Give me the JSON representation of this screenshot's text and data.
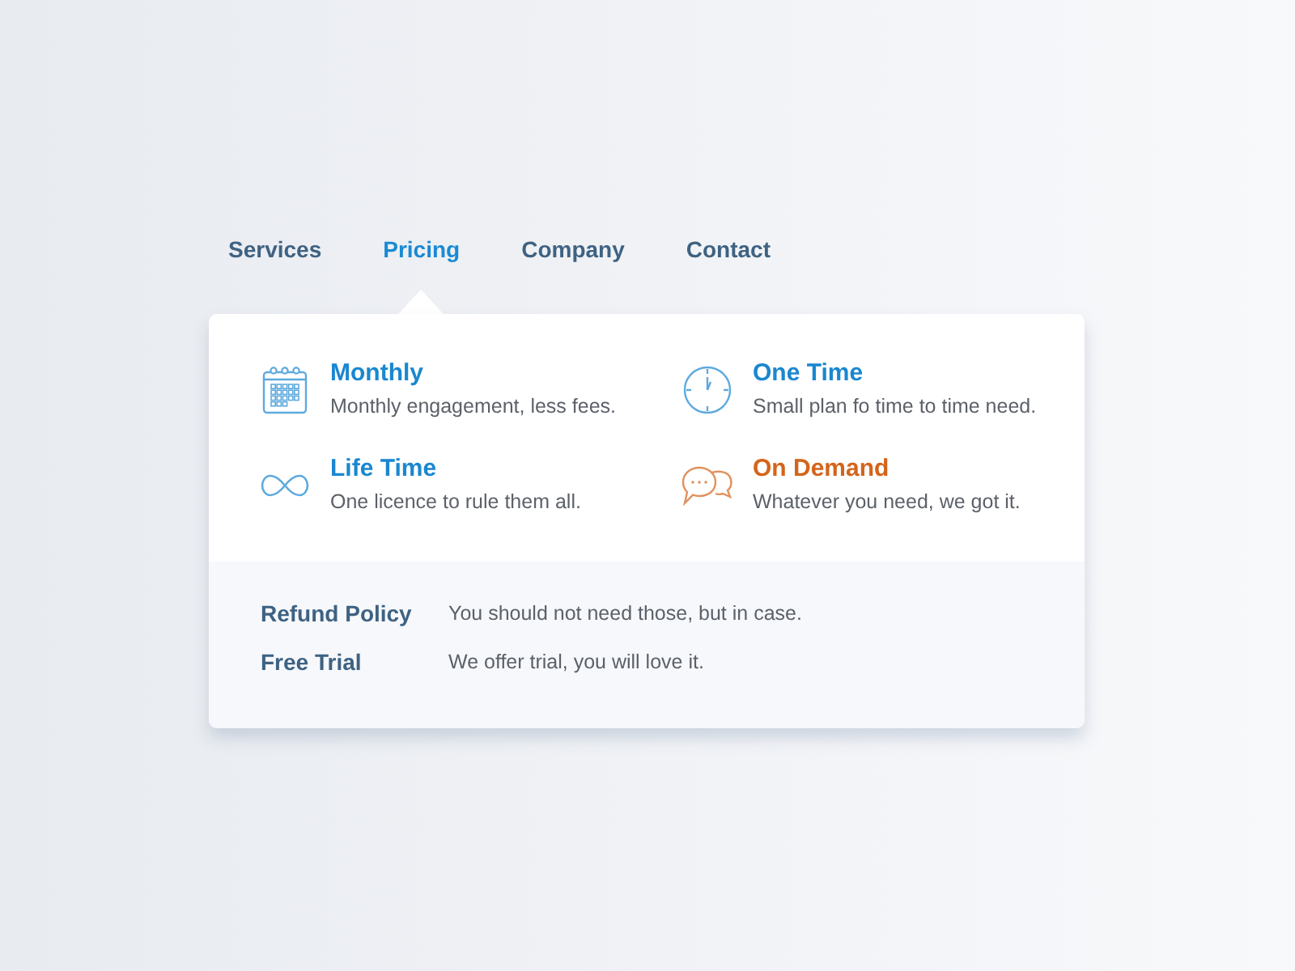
{
  "nav": {
    "tabs": [
      {
        "label": "Services",
        "selected": false
      },
      {
        "label": "Pricing",
        "selected": true
      },
      {
        "label": "Company",
        "selected": false
      },
      {
        "label": "Contact",
        "selected": false
      }
    ]
  },
  "menu": {
    "items": [
      {
        "kind": "calendar",
        "title": "Monthly",
        "description": "Monthly engagement, less fees.",
        "color": "#1a87d0"
      },
      {
        "kind": "clock",
        "title": "One Time",
        "description": "Small plan fo time to time need.",
        "color": "#1a87d0"
      },
      {
        "kind": "infinity",
        "title": "Life Time",
        "description": "One licence to rule them all.",
        "color": "#1a87d0"
      },
      {
        "kind": "chat",
        "title": "On Demand",
        "description": "Whatever you need, we got it.",
        "color": "#d4641a"
      }
    ]
  },
  "footer": [
    {
      "label": "Refund Policy",
      "text": "You should not need those, but in case."
    },
    {
      "label": "Free Trial",
      "text": "We offer trial, you will love it."
    }
  ]
}
